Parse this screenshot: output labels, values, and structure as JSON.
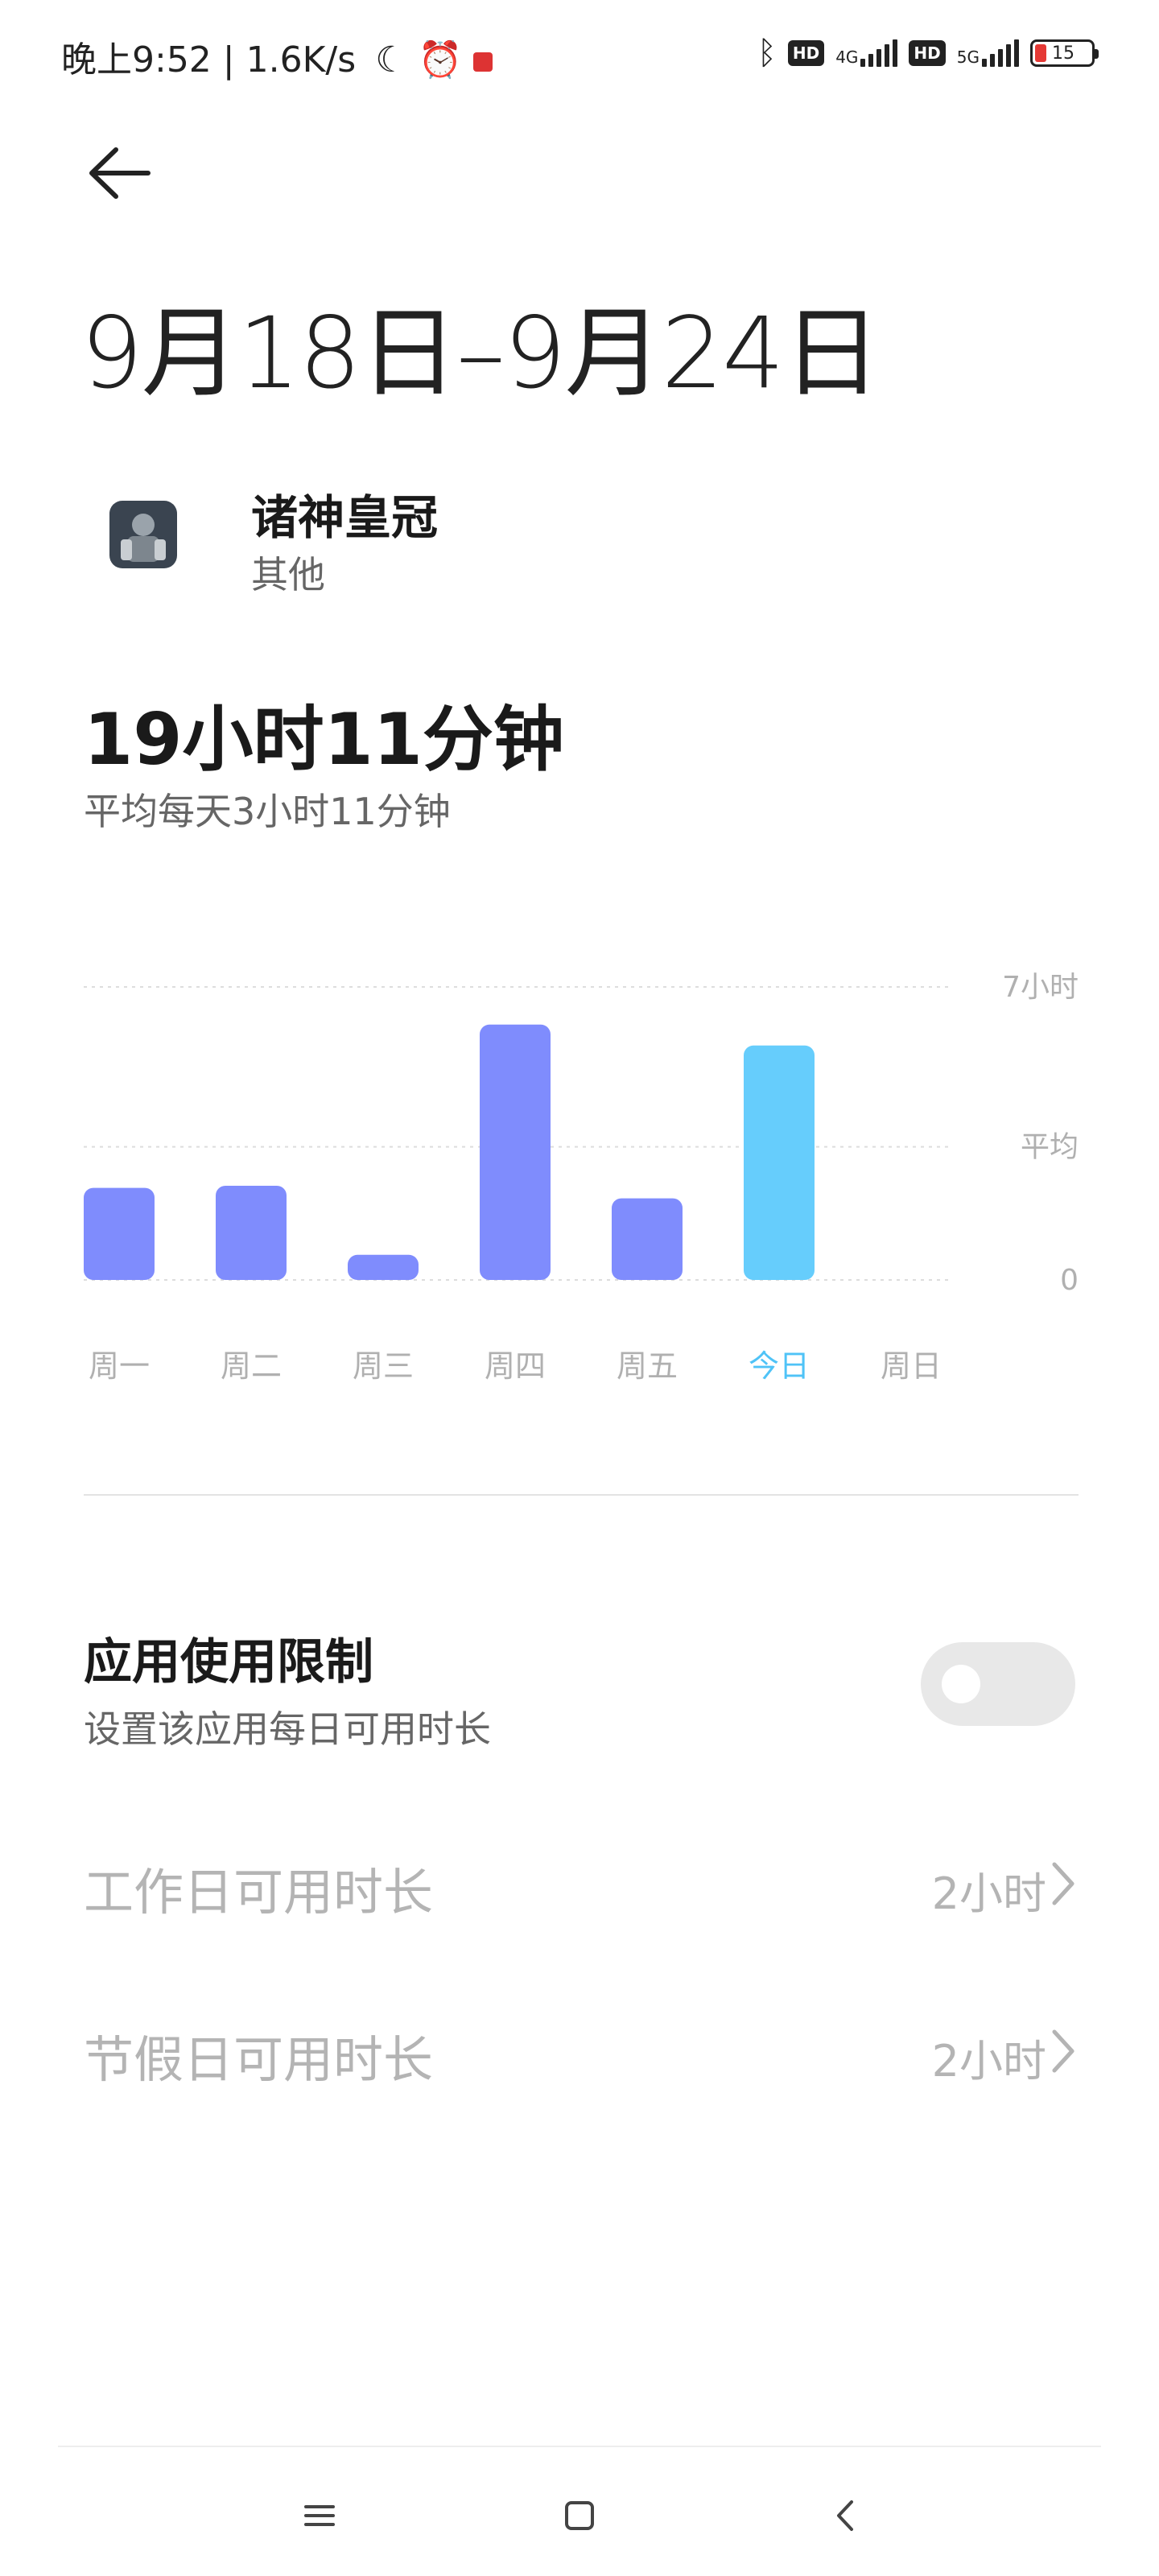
{
  "status_bar": {
    "time_text": "晚上9:52 | 1.6K/s",
    "hd1": "HD",
    "net1": "4G",
    "hd2": "HD",
    "net2": "5G",
    "battery": "15"
  },
  "header": {
    "date_range": "9月18日–9月24日"
  },
  "app": {
    "name": "诸神皇冠",
    "category": "其他"
  },
  "usage": {
    "total": "19小时11分钟",
    "average": "平均每天3小时11分钟"
  },
  "chart_data": {
    "type": "bar",
    "categories": [
      "周一",
      "周二",
      "周三",
      "周四",
      "周五",
      "今日",
      "周日"
    ],
    "values_hours": [
      2.2,
      2.25,
      0.6,
      6.1,
      1.95,
      5.6,
      0
    ],
    "highlight_index": 5,
    "ylim": [
      0,
      7
    ],
    "y_labels": {
      "max": "7小时",
      "avg": "平均",
      "zero": "0"
    },
    "average_hours": 3.18,
    "colors": {
      "bar": "#7f8cfd",
      "today": "#66cdfc",
      "today_label": "#4fc3f7",
      "axis_label": "#b0b0b0",
      "grid": "#dddddd"
    }
  },
  "limit": {
    "title": "应用使用限制",
    "description": "设置该应用每日可用时长",
    "enabled": false
  },
  "settings_rows": [
    {
      "label": "工作日可用时长",
      "value": "2小时"
    },
    {
      "label": "节假日可用时长",
      "value": "2小时"
    }
  ]
}
